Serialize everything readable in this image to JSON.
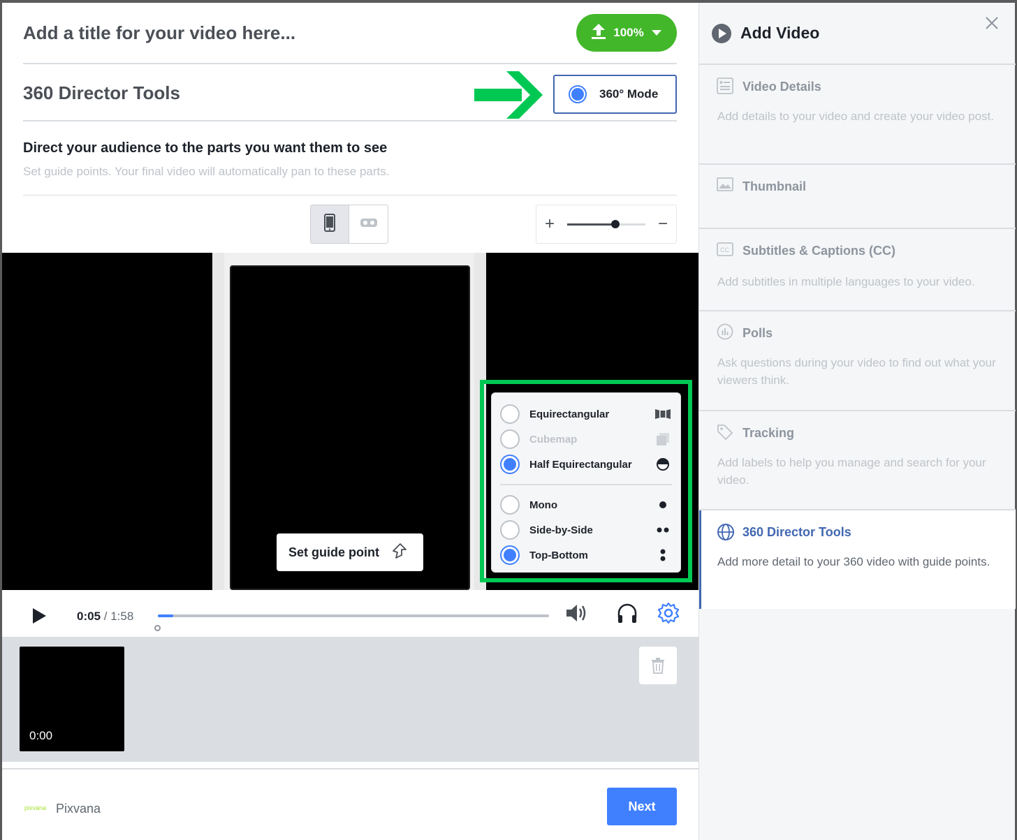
{
  "header": {
    "title_placeholder": "Add a title for your video here...",
    "upload_progress": "100%"
  },
  "director": {
    "section_title": "360 Director Tools",
    "mode_label": "360° Mode",
    "direct_title": "Direct your audience to the parts you want them to see",
    "direct_subtitle": "Set guide points. Your final video will automatically pan to these parts.",
    "zoom_plus": "+",
    "zoom_minus": "−",
    "zoom_level": 0.62
  },
  "video": {
    "guide_point_label": "Set guide point",
    "projection_options": [
      {
        "label": "Equirectangular",
        "selected": false,
        "disabled": false,
        "icon": "panorama-icon"
      },
      {
        "label": "Cubemap",
        "selected": false,
        "disabled": true,
        "icon": "cube-icon"
      },
      {
        "label": "Half Equirectangular",
        "selected": true,
        "disabled": false,
        "icon": "half-sphere-icon"
      }
    ],
    "stereo_options": [
      {
        "label": "Mono",
        "selected": false,
        "icon": "single-dot-icon"
      },
      {
        "label": "Side-by-Side",
        "selected": false,
        "icon": "horizontal-dots-icon"
      },
      {
        "label": "Top-Bottom",
        "selected": true,
        "icon": "vertical-dots-icon"
      }
    ]
  },
  "controls": {
    "current_time": "0:05",
    "separator": " / ",
    "duration": "1:58",
    "progress": 0.04
  },
  "timeline": {
    "thumb_time": "0:00"
  },
  "footer": {
    "logo_text": "pixvana",
    "brand_name": "Pixvana",
    "next_label": "Next"
  },
  "sidebar": {
    "title": "Add Video",
    "items": [
      {
        "label": "Video Details",
        "desc": "Add details to your video and create your video post.",
        "icon": "details-icon"
      },
      {
        "label": "Thumbnail",
        "desc": "",
        "icon": "image-icon"
      },
      {
        "label": "Subtitles & Captions (CC)",
        "desc": "Add subtitles in multiple languages to your video.",
        "icon": "cc-icon"
      },
      {
        "label": "Polls",
        "desc": "Ask questions during your video to find out what your viewers think.",
        "icon": "poll-icon"
      },
      {
        "label": "Tracking",
        "desc": "Add labels to help you manage and search for your video.",
        "icon": "tag-icon"
      },
      {
        "label": "360 Director Tools",
        "desc": "Add more detail to your 360 video with guide points.",
        "icon": "globe-icon"
      }
    ]
  },
  "colors": {
    "accent": "#4080ff",
    "upload_green": "#42b72a",
    "highlight_green": "#00c853",
    "active_blue": "#4267b2"
  }
}
